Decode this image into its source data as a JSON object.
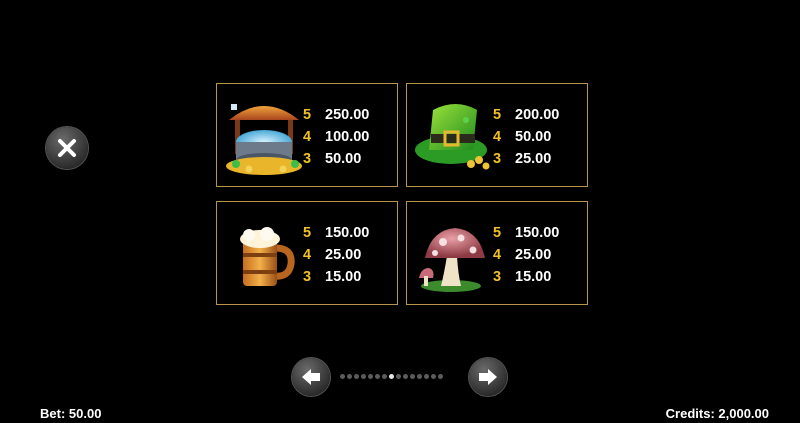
{
  "cards": [
    {
      "symbol": "wishing-well-symbol",
      "pays": [
        {
          "count": "5",
          "amount": "250.00"
        },
        {
          "count": "4",
          "amount": "100.00"
        },
        {
          "count": "3",
          "amount": "50.00"
        }
      ]
    },
    {
      "symbol": "leprechaun-hat-symbol",
      "pays": [
        {
          "count": "5",
          "amount": "200.00"
        },
        {
          "count": "4",
          "amount": "50.00"
        },
        {
          "count": "3",
          "amount": "25.00"
        }
      ]
    },
    {
      "symbol": "beer-mug-symbol",
      "pays": [
        {
          "count": "5",
          "amount": "150.00"
        },
        {
          "count": "4",
          "amount": "25.00"
        },
        {
          "count": "3",
          "amount": "15.00"
        }
      ]
    },
    {
      "symbol": "mushroom-symbol",
      "pays": [
        {
          "count": "5",
          "amount": "150.00"
        },
        {
          "count": "4",
          "amount": "25.00"
        },
        {
          "count": "3",
          "amount": "15.00"
        }
      ]
    }
  ],
  "pagination": {
    "total": 15,
    "active": 7
  },
  "footer": {
    "bet": "Bet: 50.00",
    "credits": "Credits: 2,000.00"
  },
  "colors": {
    "count": "#f2c025",
    "border": "#b79649"
  }
}
